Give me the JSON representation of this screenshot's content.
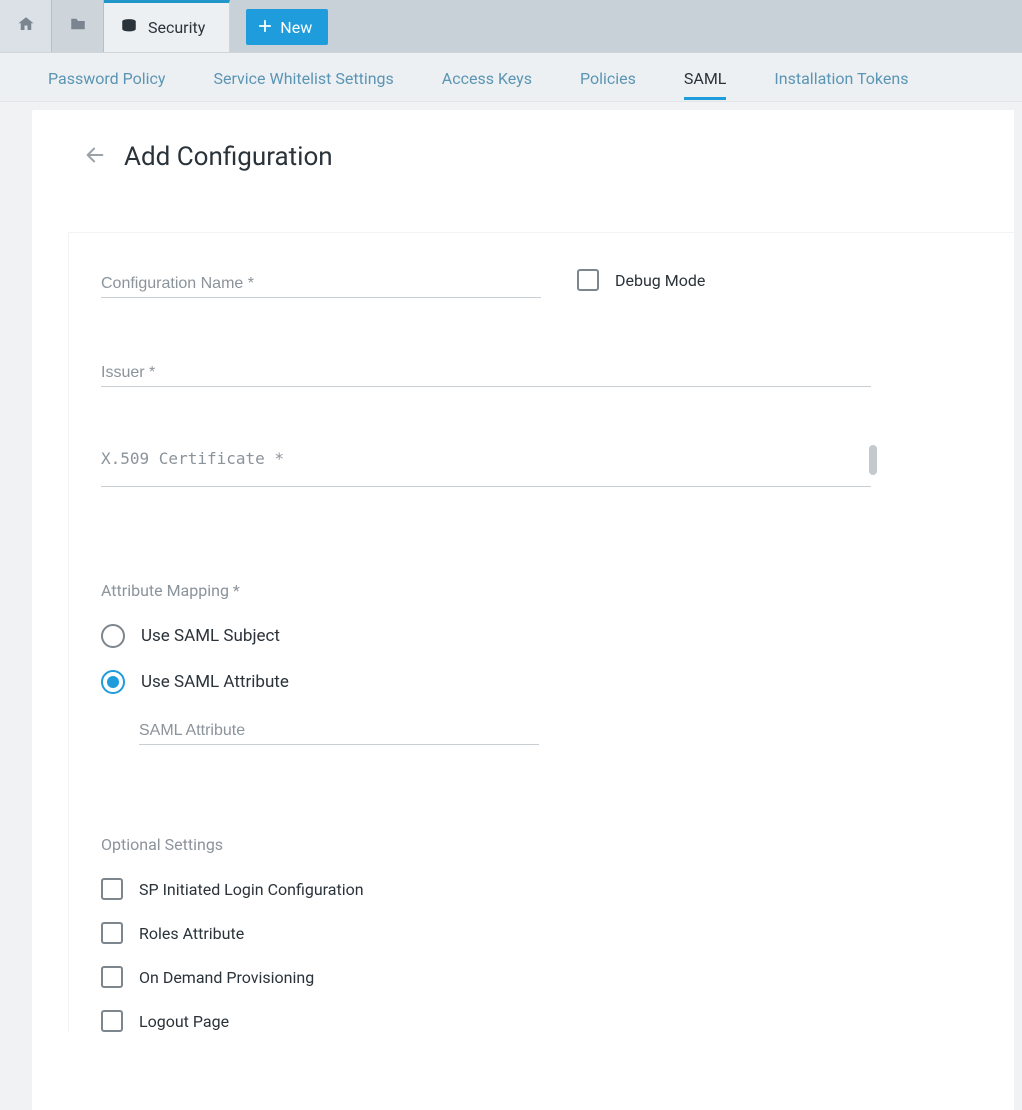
{
  "top": {
    "app_tab_label": "Security",
    "new_button_label": "New"
  },
  "tabs": [
    {
      "label": "Password Policy",
      "active": false
    },
    {
      "label": "Service Whitelist Settings",
      "active": false
    },
    {
      "label": "Access Keys",
      "active": false
    },
    {
      "label": "Policies",
      "active": false
    },
    {
      "label": "SAML",
      "active": true
    },
    {
      "label": "Installation Tokens",
      "active": false
    }
  ],
  "page": {
    "title": "Add Configuration"
  },
  "form": {
    "config_name_placeholder": "Configuration Name *",
    "debug_mode_label": "Debug Mode",
    "issuer_placeholder": "Issuer *",
    "cert_placeholder": "X.509 Certificate *",
    "attribute_mapping_label": "Attribute Mapping *",
    "radio_subject_label": "Use SAML Subject",
    "radio_attribute_label": "Use SAML Attribute",
    "saml_attribute_placeholder": "SAML Attribute",
    "optional_settings_label": "Optional Settings",
    "optional": [
      "SP Initiated Login Configuration",
      "Roles Attribute",
      "On Demand Provisioning",
      "Logout Page"
    ]
  }
}
